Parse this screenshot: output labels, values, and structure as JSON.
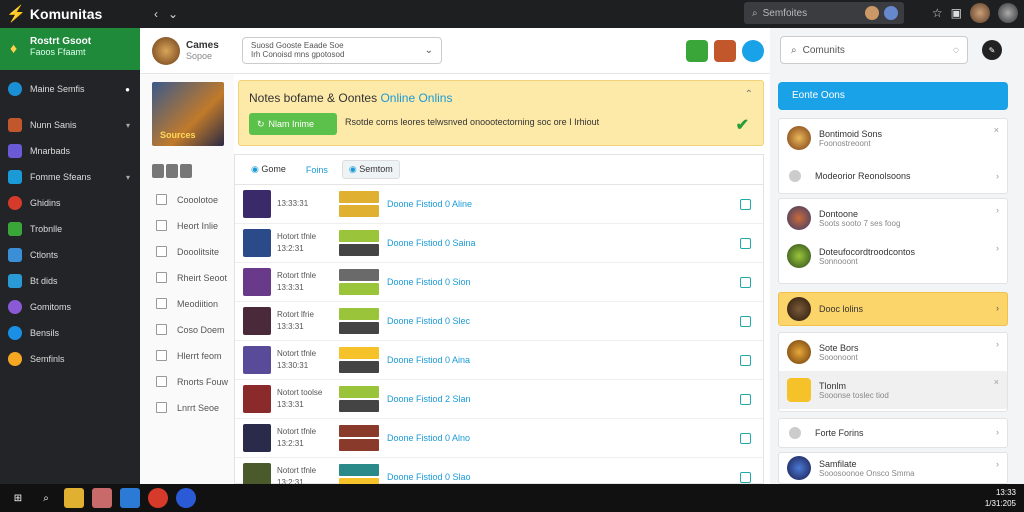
{
  "app": {
    "name": "Komunitas"
  },
  "topbar": {
    "search": "Semfoites"
  },
  "sidebar": {
    "highlight_title": "Rostrt Gsoot",
    "highlight_sub": "Faoos Ffaamt",
    "items": [
      {
        "label": "Maine Semfis",
        "icon": "chat-icon",
        "color": "#1a8fd6"
      },
      {
        "label": "Nunn Sanis",
        "icon": "game-icon",
        "color": "#c2572b"
      },
      {
        "label": "Mnarbads",
        "icon": "controller-icon",
        "color": "#6b5ad6"
      },
      {
        "label": "Fomme Sfeans",
        "icon": "store-icon",
        "color": "#1a9ad6"
      },
      {
        "label": "Ghidins",
        "icon": "record-icon",
        "color": "#d63a2a"
      },
      {
        "label": "Trobnlle",
        "icon": "leaf-icon",
        "color": "#3aa63a"
      },
      {
        "label": "Ctlonts",
        "icon": "heart-icon",
        "color": "#3a8fd6"
      },
      {
        "label": "Bt dids",
        "icon": "bot-icon",
        "color": "#2a9ad6"
      },
      {
        "label": "Gomitoms",
        "icon": "globe-icon",
        "color": "#8a5ad6"
      },
      {
        "label": "Bensils",
        "icon": "blue-icon",
        "color": "#1a8fe6"
      },
      {
        "label": "Semfinls",
        "icon": "sun-icon",
        "color": "#f5a623"
      }
    ]
  },
  "header": {
    "title": "Cames",
    "sub": "Sopoe",
    "box_line1": "Suosd Gooste Eaade Soe",
    "box_line2": "Irh Conoisd mns gpotosod"
  },
  "left": {
    "cover_label": "Sources",
    "items": [
      "Cooolotoe",
      "Heort Inlie",
      "Dooolitsite",
      "Rheirt Seoot",
      "Meodiition",
      "Coso Doem",
      "Hlerrt feom",
      "Rnorts Fouw",
      "Lnrrt Seoe"
    ]
  },
  "banner": {
    "title_a": "Notes bofame &",
    "title_b": "Oontes",
    "title_c": "Online Onlins",
    "button": "Nlam Inime",
    "text": "Rsotde corns leores telwsnved onoootectorning soc ore I Irhiout"
  },
  "list": {
    "tabs": [
      "Gome",
      "Foins",
      "Semtom"
    ],
    "rows": [
      {
        "a": "",
        "b": "13:33:31",
        "link": "Doone Fistiod  0 Aline"
      },
      {
        "a": "Hotort tfnle",
        "b": "13:2:31",
        "link": "Doone Fistiod  0 Saina"
      },
      {
        "a": "Rotort tfnle",
        "b": "13:3:31",
        "link": "Doone Fistiod  0 Sion"
      },
      {
        "a": "Rotort lfrie",
        "b": "13:3:31",
        "link": "Doone Fistiod  0 Slec"
      },
      {
        "a": "Notort tfnle",
        "b": "13:30:31",
        "link": "Doone Fistiod  0 Aina"
      },
      {
        "a": "Notort toolse",
        "b": "13:3:31",
        "link": "Doone Fistiod  2 Slan"
      },
      {
        "a": "Notort tfnle",
        "b": "13:2:31",
        "link": "Doone Fistiod  0 Alno"
      },
      {
        "a": "Notort tfnle",
        "b": "13:2:31",
        "link": "Doone Fistiod  0 Slao"
      }
    ]
  },
  "right": {
    "search": "Comunits",
    "header": "Eonte Oons",
    "cards": [
      {
        "t": "Bontimoid Sons",
        "s": "Foonostreoont"
      },
      {
        "t": "Modeorior Reonolsoons",
        "s": ""
      },
      {
        "t": "Dontoone",
        "s": "Soots sooto 7 ses foog"
      },
      {
        "t": "Doteufocordtroodcontos",
        "s": "Sonnooont"
      },
      {
        "t": "Dooc lolins",
        "s": ""
      },
      {
        "t": "Sote Bors",
        "s": "Sooonoont"
      },
      {
        "t": "Tlonlm",
        "s": "Sooonse toslec tiod"
      },
      {
        "t": "Forte Forins",
        "s": ""
      },
      {
        "t": "Samfilate",
        "s": "Sooosoonoe Onsco Smma"
      }
    ]
  },
  "taskbar": {
    "time": "13:33",
    "date": "1/31:205"
  }
}
